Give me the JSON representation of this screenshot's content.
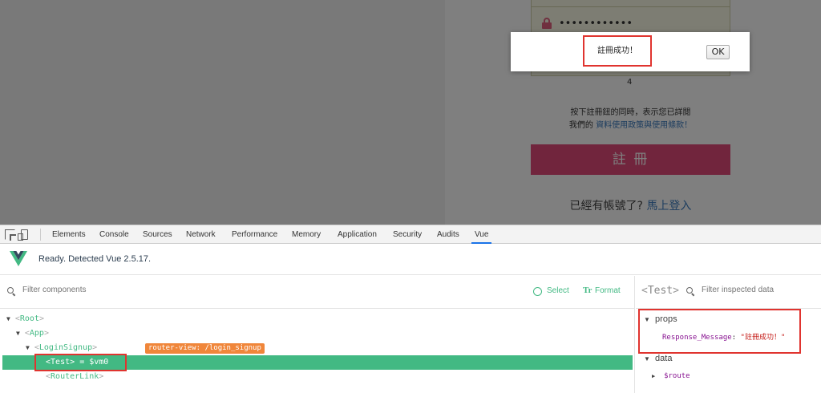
{
  "page": {
    "password_dots": "••••••••••••",
    "counter": "4",
    "terms_line1": "按下註冊鈕的同時，表示您已詳閱",
    "terms_line2_prefix": "我們的",
    "terms_line2_link": "資料使用政策與使用條款！",
    "signup_button": "註 冊",
    "login_prompt": "已經有帳號了?",
    "login_link": "馬上登入"
  },
  "alert": {
    "message": "註冊成功！",
    "ok_button": "OK"
  },
  "devtools": {
    "tabs": [
      "Elements",
      "Console",
      "Sources",
      "Network",
      "Performance",
      "Memory",
      "Application",
      "Security",
      "Audits",
      "Vue"
    ],
    "active_tab": "Vue"
  },
  "vue": {
    "status": "Ready. Detected Vue 2.5.17.",
    "filter_components_placeholder": "Filter components",
    "select_label": "Select",
    "format_label": "Format",
    "tree": {
      "root": "Root",
      "app": "App",
      "login_signup": "LoginSignup",
      "router_badge": "router-view: /login_signup",
      "test": "Test",
      "vm": "= $vm0",
      "router_link": "RouterLink"
    },
    "inspector": {
      "component": "Test",
      "filter_placeholder": "Filter inspected data",
      "props_label": "props",
      "prop_key": "Response_Message",
      "prop_value": "\"註冊成功！\"",
      "data_label": "data",
      "route_key": "$route"
    }
  },
  "colors": {
    "vue_green": "#42b983",
    "highlight_red": "#e0342f",
    "signup_pink": "#e24a7a",
    "router_badge": "#f0863a"
  }
}
